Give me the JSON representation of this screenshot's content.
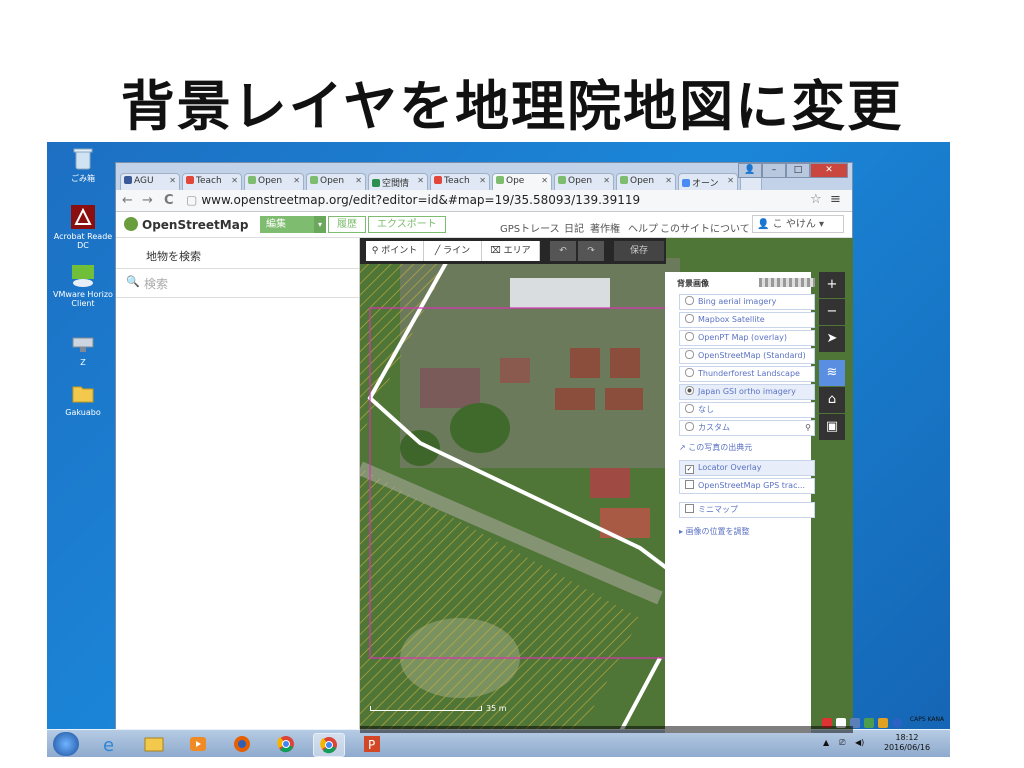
{
  "slide": {
    "title": "背景レイヤを地理院地図に変更"
  },
  "desktop": {
    "icons": [
      {
        "label": "ごみ箱",
        "icon": "recycle-bin-icon"
      },
      {
        "label": "Acrobat Reade DC",
        "icon": "acrobat-icon"
      },
      {
        "label": "VMware Horizo Client",
        "icon": "vmware-icon"
      },
      {
        "label": "Z",
        "icon": "network-drive-icon"
      },
      {
        "label": "Gakuabo",
        "icon": "folder-icon"
      }
    ]
  },
  "browser": {
    "tabs": [
      {
        "label": "AGU",
        "color": "#3b5998",
        "active": false
      },
      {
        "label": "Teach",
        "color": "#e2463b",
        "active": false
      },
      {
        "label": "Open",
        "color": "#7ebc6f",
        "active": false
      },
      {
        "label": "Open",
        "color": "#7ebc6f",
        "active": false
      },
      {
        "label": "空間情",
        "color": "#2a8f4f",
        "active": false
      },
      {
        "label": "Teach",
        "color": "#e2463b",
        "active": false
      },
      {
        "label": "Ope",
        "color": "#7ebc6f",
        "active": true
      },
      {
        "label": "Open",
        "color": "#7ebc6f",
        "active": false
      },
      {
        "label": "Open",
        "color": "#7ebc6f",
        "active": false
      },
      {
        "label": "オーン",
        "color": "#4a8af4",
        "active": false
      }
    ],
    "window_buttons": {
      "user": "👤",
      "minimize": "–",
      "maximize": "□",
      "close": "✕"
    },
    "nav": {
      "back": "←",
      "forward": "→",
      "reload": "C"
    },
    "url": "www.openstreetmap.org/edit?editor=id&#map=19/35.58093/139.39119",
    "star": "☆",
    "menu": "≡"
  },
  "osm": {
    "logo": "OpenStreetMap",
    "edit": "編集",
    "history": "履歴",
    "export": "エクスポート",
    "links": [
      "GPSトレース",
      "日記",
      "著作権",
      "ヘルプ",
      "このサイトについて"
    ],
    "user": "こ やけん",
    "user_caret": "▾"
  },
  "sidebar": {
    "title": "地物を検索",
    "search_placeholder": "検索"
  },
  "editor": {
    "tools": {
      "point": "ポイント",
      "line": "ライン",
      "area": "エリア",
      "undo": "↶",
      "redo": "↷",
      "save": "保存"
    },
    "controls": {
      "zoom_in": "+",
      "zoom_out": "−",
      "locate": "➤",
      "background": "≋",
      "map_data": "⌂",
      "help": "▣"
    },
    "scale": "35 m"
  },
  "background_panel": {
    "title": "背景画像",
    "layers": [
      {
        "label": "Bing aerial imagery",
        "selected": false
      },
      {
        "label": "Mapbox Satellite",
        "selected": false
      },
      {
        "label": "OpenPT Map (overlay)",
        "selected": false
      },
      {
        "label": "OpenStreetMap (Standard)",
        "selected": false
      },
      {
        "label": "Thunderforest Landscape",
        "selected": false
      },
      {
        "label": "Japan GSI ortho imagery",
        "selected": true
      },
      {
        "label": "なし",
        "selected": false
      },
      {
        "label": "カスタム",
        "selected": false
      }
    ],
    "source_link": "この写真の出典元",
    "overlays": [
      {
        "label": "Locator Overlay",
        "checked": true
      },
      {
        "label": "OpenStreetMap GPS trac...",
        "checked": false
      }
    ],
    "minimap": "ミニマップ",
    "adjust": "画像の位置を調整"
  },
  "tray": {
    "lang": "JP",
    "kana": "CAPS KANA",
    "time": "18:12",
    "date": "2016/06/16"
  },
  "colors": {
    "osm_green": "#7ebc6f",
    "desktop_blue": "#1b7ad0",
    "link_blue": "#5b72c4"
  }
}
